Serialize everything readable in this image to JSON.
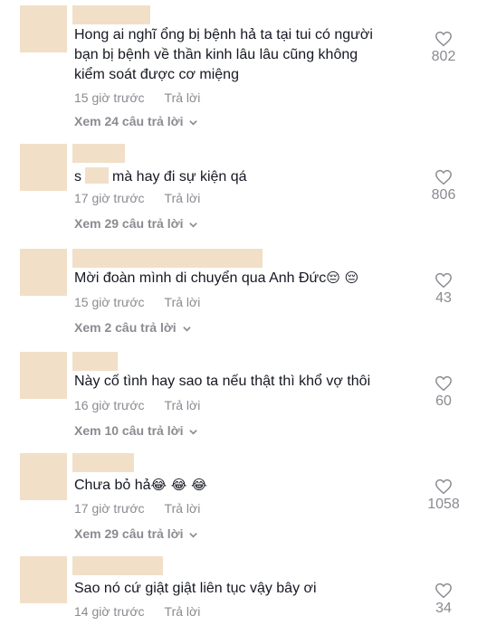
{
  "comments": [
    {
      "text": "Hong ai nghĩ ổng bị bệnh hả ta tại tui có người bạn bị bệnh về thần kinh lâu lâu cũng không kiểm soát được cơ miệng",
      "time": "15 giờ trước",
      "reply_label": "Trả lời",
      "view_replies": "Xem 24 câu trả lời",
      "likes": "802",
      "like_icon": "heart-outline",
      "chevron_icon": "chevron-down"
    },
    {
      "text_before": "s",
      "text_after": "mà hay đi sự kiện qá",
      "time": "17 giờ trước",
      "reply_label": "Trả lời",
      "view_replies": "Xem 29 câu trả lời",
      "likes": "806",
      "like_icon": "heart-outline",
      "chevron_icon": "chevron-down"
    },
    {
      "text": "Mời đoàn mình di chuyển qua Anh Đức",
      "emoji": "😔 😔",
      "time": "15 giờ trước",
      "reply_label": "Trả lời",
      "view_replies": "Xem 2 câu trả lời",
      "likes": "43",
      "like_icon": "heart-outline",
      "chevron_icon": "chevron-down"
    },
    {
      "text": "Này cố tình hay sao ta nếu thật thì khổ vợ thôi",
      "time": "16 giờ trước",
      "reply_label": "Trả lời",
      "view_replies": "Xem 10 câu trả lời",
      "likes": "60",
      "like_icon": "heart-outline",
      "chevron_icon": "chevron-down"
    },
    {
      "text": "Chưa bỏ hả",
      "emoji": "😂 😂 😂",
      "time": "17 giờ trước",
      "reply_label": "Trả lời",
      "view_replies": "Xem 29 câu trả lời",
      "likes": "1058",
      "like_icon": "heart-outline",
      "chevron_icon": "chevron-down"
    },
    {
      "text": "Sao nó cứ giật giật liên tục vậy bây ơi",
      "time": "14 giờ trước",
      "reply_label": "Trả lời",
      "likes": "34",
      "like_icon": "heart-outline"
    }
  ],
  "colors": {
    "text": "#161823",
    "muted": "#8a8b91",
    "redaction": "#f1dfc8",
    "background": "#ffffff"
  }
}
